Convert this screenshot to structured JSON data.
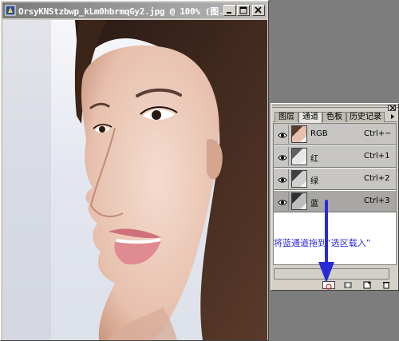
{
  "window": {
    "title": "OrsyKNStzbwp_kLm0hbrmqGy2.jpg @ 100% (图...",
    "icons": [
      "photoshop-doc-icon",
      "minimize-icon",
      "maximize-icon",
      "close-icon"
    ]
  },
  "panel": {
    "tabs": [
      {
        "label": "图层",
        "active": false
      },
      {
        "label": "通道",
        "active": true
      },
      {
        "label": "色板",
        "active": false
      },
      {
        "label": "历史记录",
        "active": false
      }
    ],
    "channels": [
      {
        "name": "RGB",
        "shortcut": "Ctrl+~",
        "selected": false
      },
      {
        "name": "红",
        "shortcut": "Ctrl+1",
        "selected": false
      },
      {
        "name": "绿",
        "shortcut": "Ctrl+2",
        "selected": false
      },
      {
        "name": "蓝",
        "shortcut": "Ctrl+3",
        "selected": true
      }
    ],
    "bottom_buttons": [
      "load-channel-as-selection-icon",
      "save-selection-as-channel-icon",
      "new-channel-icon",
      "delete-channel-icon"
    ]
  },
  "annotation": {
    "text": "将蓝通道拖到“选区载入”",
    "color": "#2a2ad8"
  }
}
